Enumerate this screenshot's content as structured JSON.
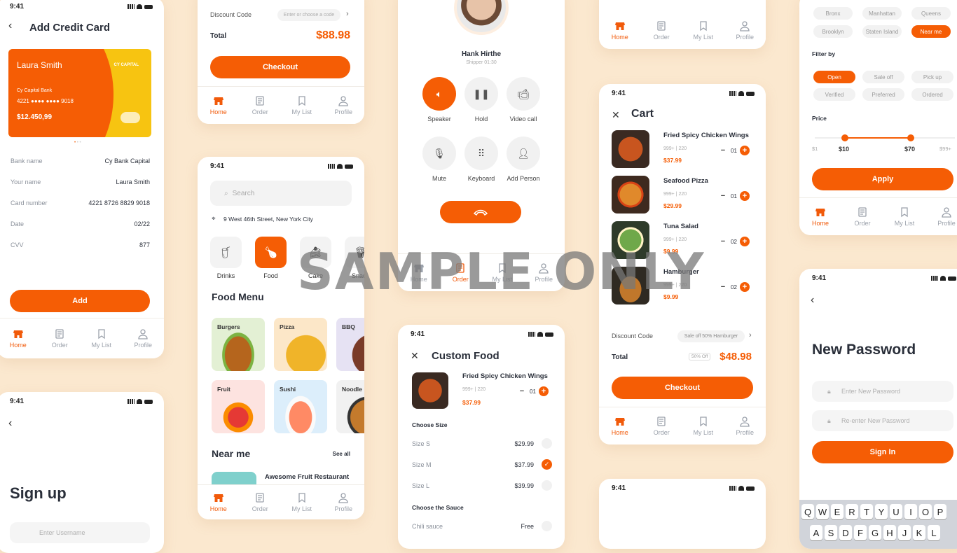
{
  "watermark": "SAMPLE ONLY",
  "nav": {
    "home": "Home",
    "order": "Order",
    "mylist": "My List",
    "profile": "Profile"
  },
  "status_time": "9:41",
  "add_card": {
    "title": "Add Credit Card",
    "card_name": "Laura Smith",
    "card_brand": "CY CAPITAL",
    "bank_small": "Cy Capital Bank",
    "card_num_a": "4221",
    "card_num_dots": "●●●● ●●●● 9018",
    "balance": "$12.450,99",
    "rows": [
      {
        "label": "Bank name",
        "value": "Cy Bank Capital"
      },
      {
        "label": "Your name",
        "value": "Laura Smith"
      },
      {
        "label": "Card number",
        "value": "4221 8726 8829 9018"
      },
      {
        "label": "Date",
        "value": "02/22"
      },
      {
        "label": "CVV",
        "value": "877"
      }
    ],
    "add_button": "Add"
  },
  "signup": {
    "title": "Sign up",
    "username_placeholder": "Enter Username"
  },
  "checkout_top": {
    "discount_label": "Discount Code",
    "discount_placeholder": "Enter or choose a code",
    "total_label": "Total",
    "total_value": "$88.98",
    "checkout_button": "Checkout"
  },
  "home": {
    "search_placeholder": "Search",
    "address": "9 West 46th Street, New York City",
    "categories": [
      "Drinks",
      "Food",
      "Cake",
      "Snack"
    ],
    "food_menu_title": "Food Menu",
    "menu": [
      "Burgers",
      "Pizza",
      "BBQ",
      "Fruit",
      "Sushi",
      "Noodle"
    ],
    "near_me": "Near me",
    "see_all": "See all",
    "restaurant": "Awesome Fruit Restaurant"
  },
  "call": {
    "name": "Hank Hirthe",
    "sub": "Shipper 01:30",
    "buttons": [
      "Speaker",
      "Hold",
      "Video call",
      "Mute",
      "Keyboard",
      "Add Person"
    ]
  },
  "custom_food": {
    "title": "Custom Food",
    "item_name": "Fried Spicy Chicken Wings",
    "item_meta": "999+ | 220",
    "item_price": "$37.99",
    "qty": "01",
    "choose_size": "Choose Size",
    "sizes": [
      {
        "label": "Size S",
        "price": "$29.99"
      },
      {
        "label": "Size M",
        "price": "$37.99"
      },
      {
        "label": "Size L",
        "price": "$39.99"
      }
    ],
    "choose_sauce": "Choose the Sauce",
    "sauce": {
      "label": "Chili sauce",
      "price": "Free"
    }
  },
  "cart": {
    "title": "Cart",
    "items": [
      {
        "name": "Fried Spicy Chicken Wings",
        "meta": "999+ | 220",
        "price": "$37.99",
        "qty": "01"
      },
      {
        "name": "Seafood Pizza",
        "meta": "999+ | 220",
        "price": "$29.99",
        "qty": "01"
      },
      {
        "name": "Tuna Salad",
        "meta": "999+ | 220",
        "price": "$9.99",
        "qty": "02"
      },
      {
        "name": "Hamburger",
        "meta": "999+ | 220",
        "price": "$9.99",
        "qty": "02"
      }
    ],
    "discount_label": "Discount Code",
    "discount_value": "Sale off 50% Hamburger",
    "total_label": "Total",
    "badge": "50% Off",
    "total_value": "$48.98",
    "checkout_button": "Checkout"
  },
  "filter": {
    "areas": [
      "Bronx",
      "Manhattan",
      "Queens",
      "Brooklyn",
      "Staten Island",
      "Near me"
    ],
    "filter_by": "Filter by",
    "filters": [
      "Open",
      "Sale off",
      "Pick up",
      "Verified",
      "Preferred",
      "Ordered"
    ],
    "price_label": "Price",
    "price_ticks": [
      "$1",
      "$10",
      "$70",
      "$99+"
    ],
    "apply_button": "Apply"
  },
  "new_password": {
    "title": "New Password",
    "new_placeholder": "Enter New Password",
    "reenter_placeholder": "Re-enter New Password",
    "signin_button": "Sign In",
    "keys_row1": [
      "Q",
      "W",
      "E",
      "R",
      "T",
      "Y",
      "U",
      "I",
      "O",
      "P"
    ],
    "keys_row2": [
      "A",
      "S",
      "D",
      "F",
      "G",
      "H",
      "J",
      "K",
      "L"
    ]
  },
  "colors": {
    "accent": "#f55d05",
    "background": "#fbe8cf",
    "card_yellow": "#f7c411"
  }
}
